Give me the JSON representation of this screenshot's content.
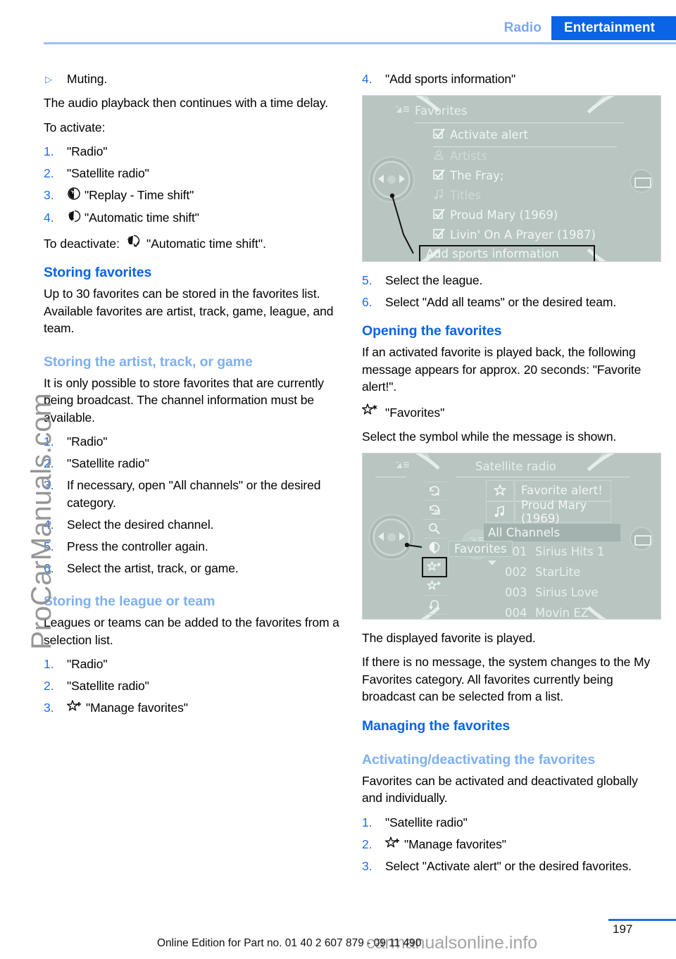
{
  "header": {
    "tab_inactive": "Radio",
    "tab_active": "Entertainment"
  },
  "colors": {
    "accent_blue": "#0b63e5",
    "light_blue": "#7fb0ef",
    "screen_bg": "#b8c5c1"
  },
  "left_column": {
    "bullet": {
      "marker": "▷",
      "text": "Muting."
    },
    "para1": "The audio playback then continues with a time delay.",
    "para2": "To activate:",
    "steps_activate": [
      {
        "num": "1.",
        "text": "\"Radio\"",
        "symbol": ""
      },
      {
        "num": "2.",
        "text": "\"Satellite radio\"",
        "symbol": ""
      },
      {
        "num": "3.",
        "text": "\"Replay - Time shift\"",
        "symbol": "replay-time-shift-icon"
      },
      {
        "num": "4.",
        "text": "\"Automatic time shift\"",
        "symbol": "automatic-time-shift-icon"
      }
    ],
    "deactivate_prefix": "To deactivate:",
    "deactivate_text": "\"Automatic time shift\".",
    "deactivate_symbol": "automatic-time-shift-off-icon",
    "h_storing_favorites": "Storing favorites",
    "para_storing_favorites": "Up to 30 favorites can be stored in the favorites list. Available favorites are artist, track, game, league, and team.",
    "h_storing_artist": "Storing the artist, track, or game",
    "para_storing_artist": "It is only possible to store favorites that are currently being broadcast. The channel information must be available.",
    "steps_artist": [
      {
        "num": "1.",
        "text": "\"Radio\""
      },
      {
        "num": "2.",
        "text": "\"Satellite radio\""
      },
      {
        "num": "3.",
        "text": "If necessary, open \"All channels\" or the desired category."
      },
      {
        "num": "4.",
        "text": "Select the desired channel."
      },
      {
        "num": "5.",
        "text": "Press the controller again."
      },
      {
        "num": "6.",
        "text": "Select the artist, track, or game."
      }
    ],
    "h_storing_league": "Storing the league or team",
    "para_storing_league": "Leagues or teams can be added to the favorites from a selection list.",
    "steps_league": [
      {
        "num": "1.",
        "text": "\"Radio\"",
        "symbol": ""
      },
      {
        "num": "2.",
        "text": "\"Satellite radio\"",
        "symbol": ""
      },
      {
        "num": "3.",
        "text": "\"Manage favorites\"",
        "symbol": "manage-favorites-icon"
      }
    ]
  },
  "right_column": {
    "step4": {
      "num": "4.",
      "text": "\"Add sports information\""
    },
    "screen1": {
      "title": "Favorites",
      "rows": [
        {
          "icon": "checkbox-checked-icon",
          "label": "Activate alert",
          "dim": false
        },
        {
          "icon": "artist-icon",
          "label": "Artists",
          "dim": true
        },
        {
          "icon": "checkbox-checked-icon",
          "label": "The Fray;",
          "dim": false
        },
        {
          "icon": "music-note-icon",
          "label": "Titles",
          "dim": true
        },
        {
          "icon": "checkbox-checked-icon",
          "label": "Proud Mary (1969)",
          "dim": false
        },
        {
          "icon": "checkbox-checked-icon",
          "label": "Livin' On A Prayer (1987)",
          "dim": false
        }
      ],
      "callout": "Add sports information"
    },
    "steps_after": [
      {
        "num": "5.",
        "text": "Select the league."
      },
      {
        "num": "6.",
        "text": "Select \"Add all teams\" or the desired team."
      }
    ],
    "h_opening": "Opening the favorites",
    "para_opening": "If an activated favorite is played back, the following message appears for approx. 20 seconds: \"Favorite alert!\".",
    "favorites_symline": "\"Favorites\"",
    "favorites_symbol": "favorites-star-icon",
    "para_select_symbol": "Select the symbol while the message is shown.",
    "screen2": {
      "title": "Satellite radio",
      "msg_star_label": "Favorite alert!",
      "msg_note_label": "Proud Mary (1969)",
      "all_channels": "All Channels",
      "favorites_chip": "Favorites",
      "sidebar_icons": [
        "refresh-scan-icon",
        "refresh-category-icon",
        "search-icon",
        "replay-time-shift-icon",
        "favorites-star-icon",
        "manage-favorites-icon",
        "back-arrow-icon"
      ],
      "selected_icon_index": 4,
      "channels": [
        {
          "num": "001",
          "name": "Sirius Hits 1"
        },
        {
          "num": "002",
          "name": "StarLite"
        },
        {
          "num": "003",
          "name": "Sirius Love"
        },
        {
          "num": "004",
          "name": "Movin EZ"
        }
      ]
    },
    "para_displayed": "The displayed favorite is played.",
    "para_nomessage": "If there is no message, the system changes to the My Favorites category. All favorites currently being broadcast can be selected from a list.",
    "h_managing": "Managing the favorites",
    "h_activating": "Activating/deactivating the favorites",
    "para_activating": "Favorites can be activated and deactivated globally and individually.",
    "steps_activating": [
      {
        "num": "1.",
        "text": "\"Satellite radio\"",
        "symbol": ""
      },
      {
        "num": "2.",
        "text": "\"Manage favorites\"",
        "symbol": "manage-favorites-icon"
      },
      {
        "num": "3.",
        "text": "Select \"Activate alert\" or the desired favorites.",
        "symbol": ""
      }
    ]
  },
  "watermarks": {
    "left": "ProCarManuals.com",
    "bottom": "carmanualsonline.info"
  },
  "footer": {
    "edition": "Online Edition for Part no. 01 40 2 607 879 - 09 11 490",
    "page": "197"
  }
}
